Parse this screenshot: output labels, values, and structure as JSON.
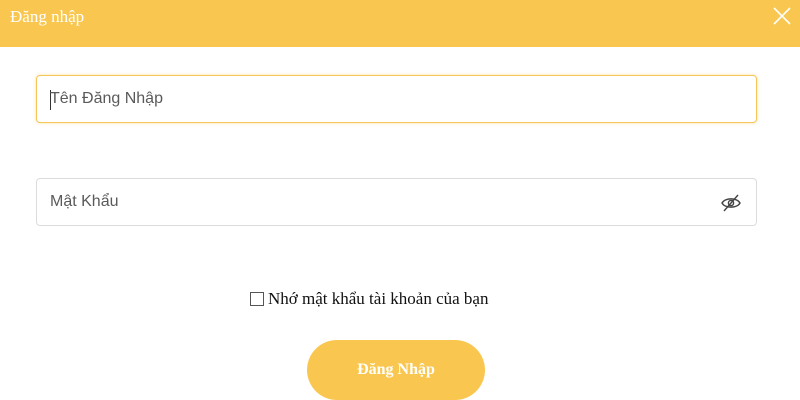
{
  "dialog": {
    "title": "Đăng nhập"
  },
  "form": {
    "username": {
      "placeholder": "Tên Đăng Nhập",
      "value": ""
    },
    "password": {
      "placeholder": "Mật Khẩu",
      "value": ""
    },
    "remember_label": "Nhớ mật khẩu tài khoản của bạn",
    "remember_checked": false,
    "submit_label": "Đăng Nhập"
  },
  "icons": {
    "close": "close-icon",
    "toggle_password": "eye-off-icon"
  },
  "colors": {
    "accent": "#f9c74f",
    "focus_border": "#f6c65a"
  }
}
